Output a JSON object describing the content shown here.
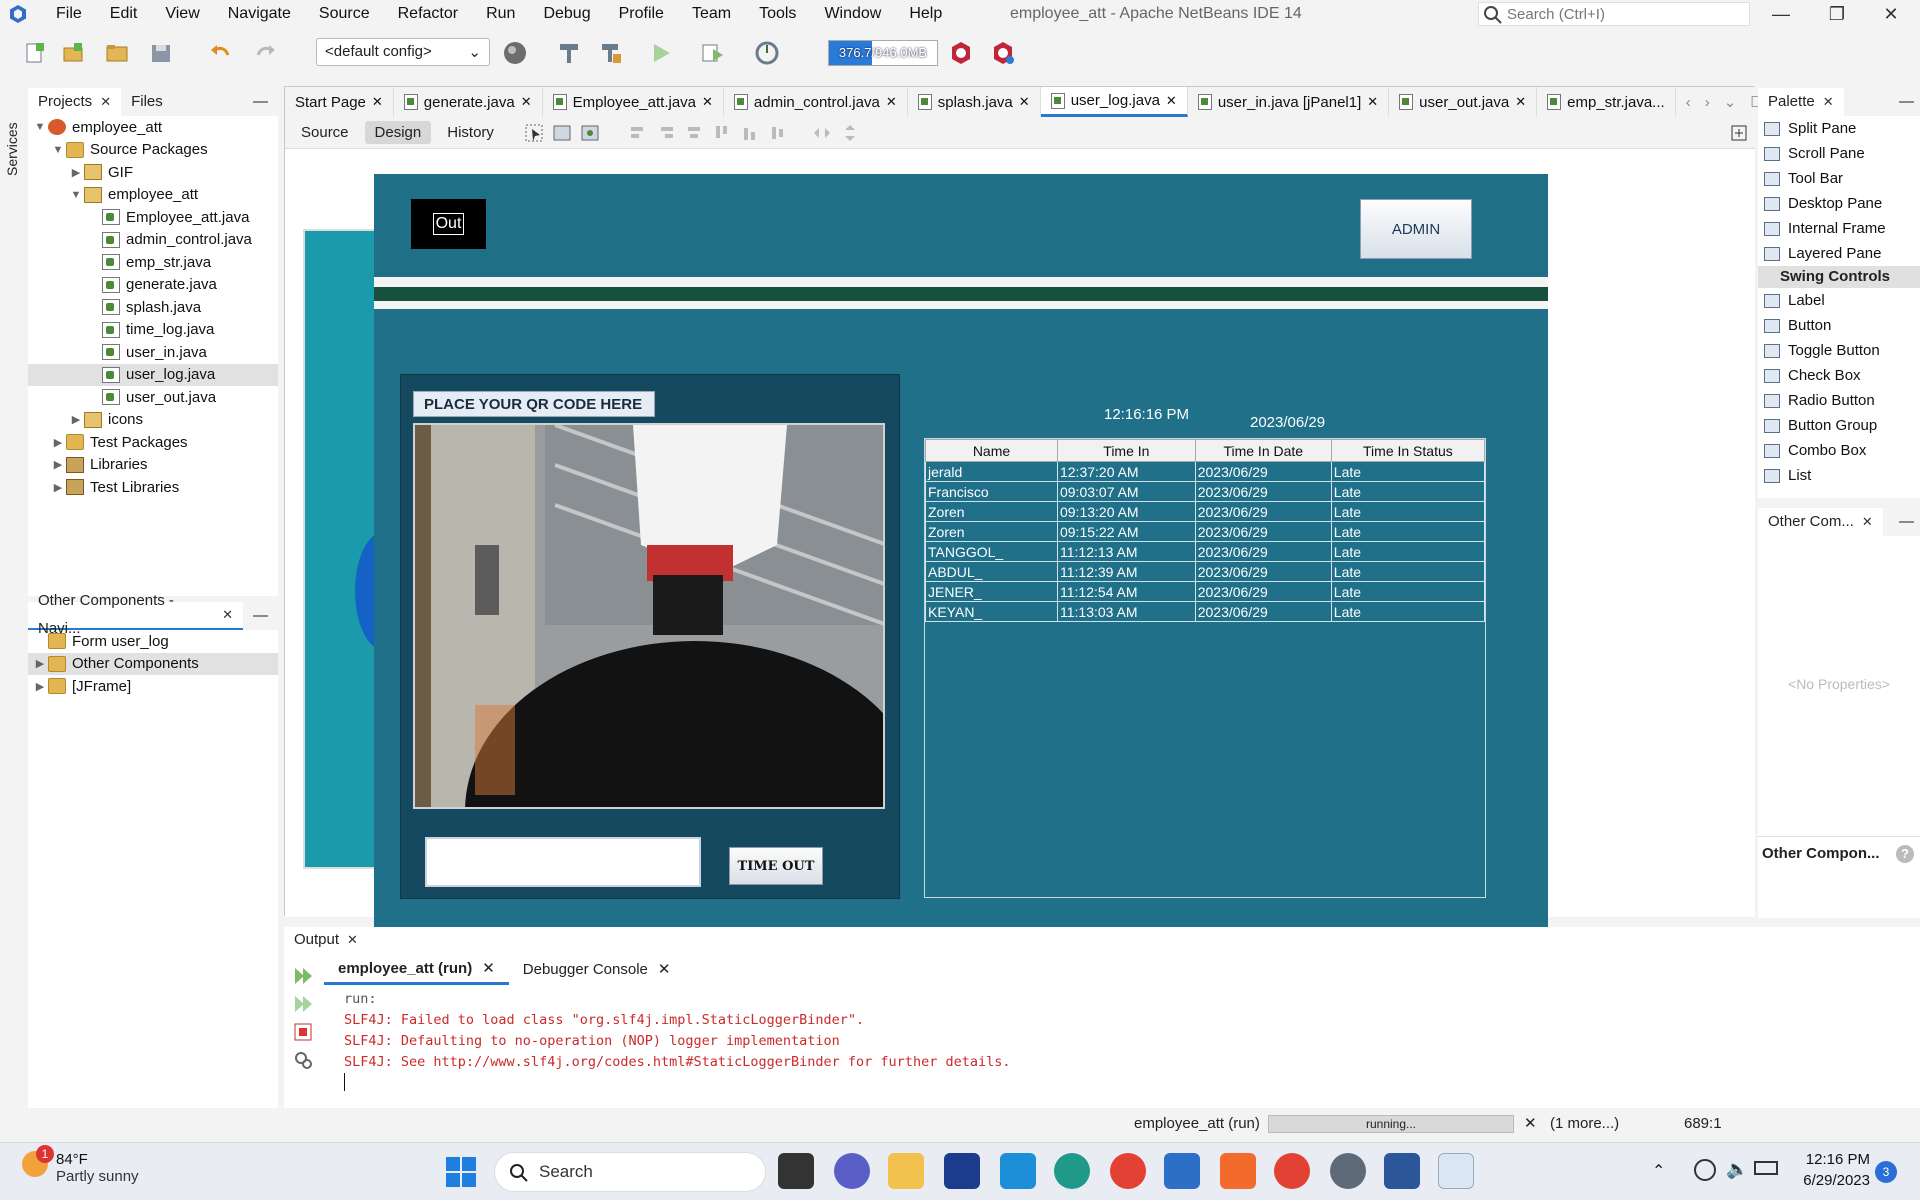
{
  "menubar": {
    "items": [
      "File",
      "Edit",
      "View",
      "Navigate",
      "Source",
      "Refactor",
      "Run",
      "Debug",
      "Profile",
      "Team",
      "Tools",
      "Window",
      "Help"
    ],
    "window_title": "employee_att - Apache NetBeans IDE 14",
    "search_placeholder": "Search (Ctrl+I)"
  },
  "toolbar": {
    "config": "<default config>",
    "memory": "376.7/946.0MB",
    "memory_fraction": 0.4
  },
  "projects": {
    "tabs": [
      "Projects",
      "Files"
    ],
    "tree": [
      {
        "label": "employee_att",
        "kind": "proj",
        "indent": 0,
        "tw": "▼"
      },
      {
        "label": "Source Packages",
        "kind": "folder",
        "indent": 1,
        "tw": "▼"
      },
      {
        "label": "GIF",
        "kind": "pkg",
        "indent": 2,
        "tw": "▶"
      },
      {
        "label": "employee_att",
        "kind": "pkg",
        "indent": 2,
        "tw": "▼"
      },
      {
        "label": "Employee_att.java",
        "kind": "java",
        "indent": 3,
        "tw": ""
      },
      {
        "label": "admin_control.java",
        "kind": "java",
        "indent": 3,
        "tw": ""
      },
      {
        "label": "emp_str.java",
        "kind": "java",
        "indent": 3,
        "tw": ""
      },
      {
        "label": "generate.java",
        "kind": "java",
        "indent": 3,
        "tw": ""
      },
      {
        "label": "splash.java",
        "kind": "java",
        "indent": 3,
        "tw": ""
      },
      {
        "label": "time_log.java",
        "kind": "java",
        "indent": 3,
        "tw": ""
      },
      {
        "label": "user_in.java",
        "kind": "java",
        "indent": 3,
        "tw": ""
      },
      {
        "label": "user_log.java",
        "kind": "java",
        "indent": 3,
        "tw": "",
        "selected": true
      },
      {
        "label": "user_out.java",
        "kind": "java",
        "indent": 3,
        "tw": ""
      },
      {
        "label": "icons",
        "kind": "pkg",
        "indent": 2,
        "tw": "▶"
      },
      {
        "label": "Test Packages",
        "kind": "folder",
        "indent": 1,
        "tw": "▶"
      },
      {
        "label": "Libraries",
        "kind": "lib",
        "indent": 1,
        "tw": "▶"
      },
      {
        "label": "Test Libraries",
        "kind": "lib",
        "indent": 1,
        "tw": "▶"
      }
    ],
    "services_label": "Services"
  },
  "navigator": {
    "title": "Other Components - Navi...",
    "tree": [
      {
        "label": "Form user_log",
        "indent": 0,
        "tw": ""
      },
      {
        "label": "Other Components",
        "indent": 0,
        "tw": "▶",
        "selected": true
      },
      {
        "label": "[JFrame]",
        "indent": 0,
        "tw": "▶"
      }
    ]
  },
  "editor": {
    "tabs": [
      "Start Page",
      "generate.java",
      "Employee_att.java",
      "admin_control.java",
      "splash.java",
      "user_log.java",
      "user_in.java [jPanel1]",
      "user_out.java",
      "emp_str.java..."
    ],
    "active_tab": "user_log.java",
    "modes": [
      "Source",
      "Design",
      "History"
    ]
  },
  "app": {
    "out_label": "Out",
    "admin_label": "ADMIN",
    "qr_label": "PLACE YOUR QR CODE HERE",
    "timeout_label": "TIME OUT",
    "clock": "12:16:16 PM",
    "date": "2023/06/29",
    "table": {
      "headers": [
        "Name",
        "Time In",
        "Time In Date",
        "Time In Status"
      ],
      "rows": [
        [
          "jerald",
          "12:37:20 AM",
          "2023/06/29",
          "Late"
        ],
        [
          "Francisco",
          "09:03:07 AM",
          "2023/06/29",
          "Late"
        ],
        [
          "Zoren",
          "09:13:20 AM",
          "2023/06/29",
          "Late"
        ],
        [
          "Zoren",
          "09:15:22 AM",
          "2023/06/29",
          "Late"
        ],
        [
          "TANGGOL_",
          "11:12:13 AM",
          "2023/06/29",
          "Late"
        ],
        [
          "ABDUL_",
          "11:12:39 AM",
          "2023/06/29",
          "Late"
        ],
        [
          "JENER_",
          "11:12:54 AM",
          "2023/06/29",
          "Late"
        ],
        [
          "KEYAN_",
          "11:13:03 AM",
          "2023/06/29",
          "Late"
        ]
      ]
    }
  },
  "palette": {
    "title": "Palette",
    "items_top": [
      "Split Pane",
      "Scroll Pane",
      "Tool Bar",
      "Desktop Pane",
      "Internal Frame",
      "Layered Pane"
    ],
    "category": "Swing Controls",
    "items_bottom": [
      "Label",
      "Button",
      "Toggle Button",
      "Check Box",
      "Radio Button",
      "Button Group",
      "Combo Box",
      "List"
    ]
  },
  "properties": {
    "title": "Other Com...",
    "empty": "<No Properties>",
    "footer": "Other Compon..."
  },
  "output": {
    "title": "Output",
    "tabs": [
      "employee_att (run)",
      "Debugger Console"
    ],
    "lines": [
      "run:",
      "SLF4J: Failed to load class \"org.slf4j.impl.StaticLoggerBinder\".",
      "SLF4J: Defaulting to no-operation (NOP) logger implementation",
      "SLF4J: See http://www.slf4j.org/codes.html#StaticLoggerBinder for further details."
    ]
  },
  "status": {
    "running_label": "employee_att (run)",
    "progress": "running...",
    "more": "(1 more...)",
    "position": "689:1"
  },
  "taskbar": {
    "temp": "84°F",
    "weather": "Partly sunny",
    "badge": "1",
    "search": "Search",
    "time": "12:16 PM",
    "date": "6/29/2023",
    "notifications": "3"
  }
}
